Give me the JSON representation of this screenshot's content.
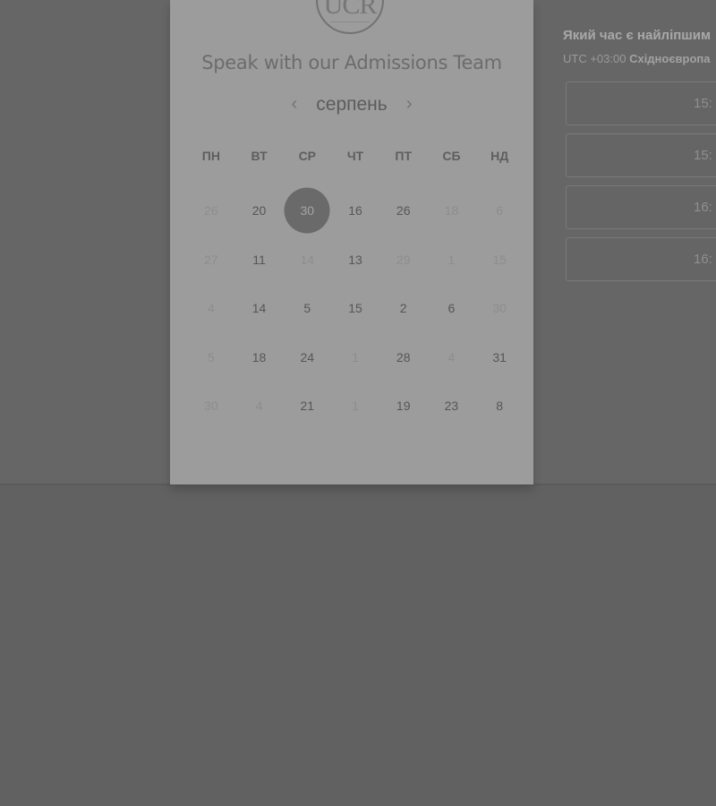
{
  "logo": {
    "text": "UCR"
  },
  "title": "Speak with our Admissions Team",
  "month_nav": {
    "prev": "‹",
    "label": "серпень",
    "next": "›"
  },
  "weekdays": [
    "ПН",
    "ВТ",
    "СР",
    "ЧТ",
    "ПТ",
    "СБ",
    "НД"
  ],
  "days": [
    [
      {
        "label": "26",
        "muted": true
      },
      {
        "label": "20"
      },
      {
        "label": "30",
        "selected": true
      },
      {
        "label": "16"
      },
      {
        "label": "26"
      },
      {
        "label": "18",
        "muted": true
      },
      {
        "label": "6",
        "muted": true
      }
    ],
    [
      {
        "label": "27",
        "muted": true
      },
      {
        "label": "11"
      },
      {
        "label": "14",
        "muted": true
      },
      {
        "label": "13"
      },
      {
        "label": "29",
        "muted": true
      },
      {
        "label": "1",
        "muted": true
      },
      {
        "label": "15",
        "muted": true
      }
    ],
    [
      {
        "label": "4",
        "muted": true
      },
      {
        "label": "14"
      },
      {
        "label": "5"
      },
      {
        "label": "15"
      },
      {
        "label": "2"
      },
      {
        "label": "6"
      },
      {
        "label": "30",
        "muted": true
      }
    ],
    [
      {
        "label": "5",
        "muted": true
      },
      {
        "label": "18"
      },
      {
        "label": "24"
      },
      {
        "label": "1",
        "muted": true
      },
      {
        "label": "28"
      },
      {
        "label": "4",
        "muted": true
      },
      {
        "label": "31"
      }
    ],
    [
      {
        "label": "30",
        "muted": true
      },
      {
        "label": "4",
        "muted": true
      },
      {
        "label": "21"
      },
      {
        "label": "1",
        "muted": true
      },
      {
        "label": "19"
      },
      {
        "label": "23"
      },
      {
        "label": "8"
      }
    ]
  ],
  "times_panel": {
    "title": "Який час є найліпшим",
    "tz_prefix": "UTC +03:00",
    "tz_name": "Східноєвропа",
    "slots": [
      "15:",
      "15:",
      "16:",
      "16:"
    ]
  },
  "colors": {
    "overlay": "#666666",
    "panel": "#9c9c9c",
    "selected_day": "#6a6a6a"
  }
}
